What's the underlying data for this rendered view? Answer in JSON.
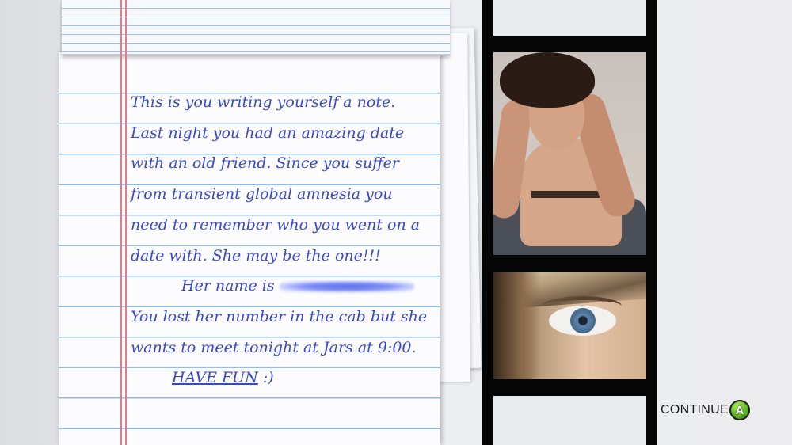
{
  "note": {
    "lines": [
      "This is you writing yourself a note.",
      "Last night you had an amazing date",
      "with an old friend.  Since you suffer",
      "from transient global amnesia you",
      "need to remember who you went on a",
      "date with.  She may be the one!!!"
    ],
    "her_name_label": "Her name is",
    "lines_after": [
      "You lost her number in the cab but she",
      "wants to meet tonight at Jars at 9:00."
    ],
    "have_fun": "HAVE FUN",
    "smiley": " :)"
  },
  "continue": {
    "label": "CONTINUE",
    "button_glyph": "A",
    "button_color": "#5cb81e"
  },
  "colors": {
    "ink": "#3848c8",
    "rule_lines": "#8fbde6",
    "margin_line": "#e77a86",
    "film": "#050505"
  }
}
